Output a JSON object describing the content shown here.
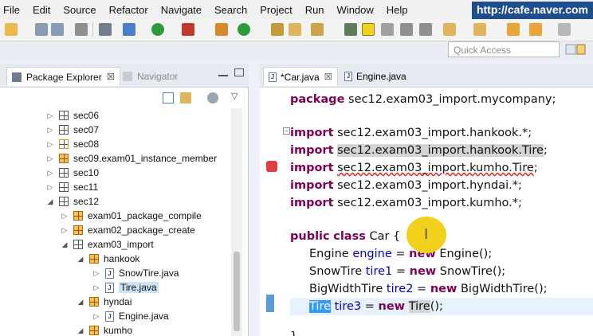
{
  "menu": [
    "File",
    "Edit",
    "Source",
    "Refactor",
    "Navigate",
    "Search",
    "Project",
    "Run",
    "Window",
    "Help"
  ],
  "watermark": "http://cafe.naver.com",
  "quick_access_placeholder": "Quick Access",
  "left_panel": {
    "tabs": [
      {
        "label": "Package Explorer",
        "active": true,
        "close": "☒"
      },
      {
        "label": "Navigator",
        "active": false
      }
    ],
    "tree": [
      {
        "label": "sec06",
        "icon": "package-icon",
        "expanded": false
      },
      {
        "label": "sec07",
        "icon": "package-icon",
        "expanded": false
      },
      {
        "label": "sec08",
        "icon": "package-warning-icon",
        "expanded": false
      },
      {
        "label": "sec09.exam01_instance_member",
        "icon": "package-open-icon",
        "expanded": false
      },
      {
        "label": "sec10",
        "icon": "package-icon",
        "expanded": false
      },
      {
        "label": "sec11",
        "icon": "package-icon",
        "expanded": false
      },
      {
        "label": "sec12",
        "icon": "package-icon",
        "expanded": true
      },
      {
        "label": "exam01_package_compile",
        "icon": "package-open-icon",
        "expanded": false
      },
      {
        "label": "exam02_package_create",
        "icon": "package-open-icon",
        "expanded": false
      },
      {
        "label": "exam03_import",
        "icon": "package-icon",
        "expanded": true
      },
      {
        "label": "hankook",
        "icon": "package-open-icon",
        "expanded": true
      },
      {
        "label": "SnowTire.java",
        "icon": "java-file-icon",
        "expanded": false
      },
      {
        "label": "Tire.java",
        "icon": "java-file-icon",
        "expanded": false,
        "selected": true
      },
      {
        "label": "hyndai",
        "icon": "package-open-icon",
        "expanded": true
      },
      {
        "label": "Engine.java",
        "icon": "java-file-icon",
        "expanded": false
      },
      {
        "label": "kumho",
        "icon": "package-open-icon",
        "expanded": true
      }
    ]
  },
  "editor": {
    "tabs": [
      {
        "label": "*Car.java",
        "active": true,
        "close": "☒"
      },
      {
        "label": "Engine.java",
        "active": false
      }
    ],
    "code": {
      "package_kw": "package",
      "package_name": " sec12.exam03_import.mycompany;",
      "import_kw": "import",
      "import1": " sec12.exam03_import.hankook.*;",
      "import2": "sec12.exam03_import.hankook.Tire",
      "import3": "sec12.exam03_import.kumho.Tire",
      "import4": " sec12.exam03_import.hyndai.*;",
      "import5": " sec12.exam03_import.kumho.*;",
      "semicolon": ";",
      "public_kw": "public",
      "class_kw": "class",
      "class_name": " Car {",
      "field1_type": "Engine ",
      "field1_name": "engine",
      "field1_eq": " = ",
      "new_kw": "new",
      "field1_ctor": " Engine();",
      "field2_type": "SnowTire ",
      "field2_name": "tire1",
      "field2_ctor": " SnowTire();",
      "field3_type": "BigWidthTire ",
      "field3_name": "tire2",
      "field3_ctor": " BigWidthTire();",
      "field4_type": "Tire",
      "field4_name": "tire3",
      "field4_ctor_type": "Tire",
      "field4_end": "();",
      "space": " ",
      "brace_close": "}"
    }
  },
  "colors": {
    "keyword": "#7f0055",
    "field": "#0000c0",
    "selection": "#3399ff",
    "error_underline": "#e02020",
    "cursor_highlight": "#f2d11d"
  }
}
